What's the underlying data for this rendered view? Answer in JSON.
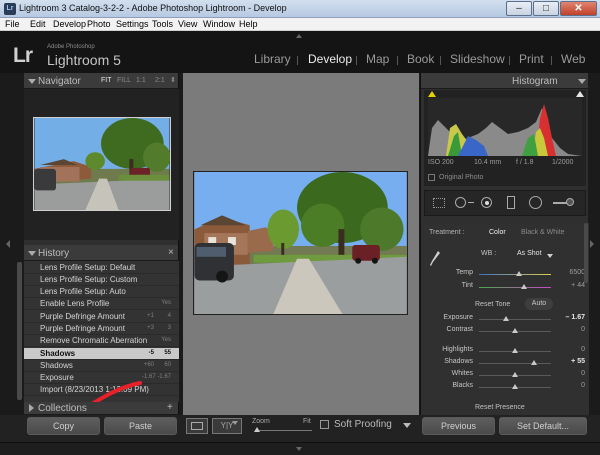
{
  "window": {
    "title": "Lightroom 3 Catalog-3-2-2 - Adobe Photoshop Lightroom - Develop",
    "icon_text": "Lr",
    "buttons": {
      "minimize": "–",
      "maximize": "□",
      "close": "✕"
    }
  },
  "menu": [
    "File",
    "Edit",
    "Develop",
    "Photo",
    "Settings",
    "Tools",
    "View",
    "Window",
    "Help"
  ],
  "identity": {
    "logo": "Lr",
    "sub": "Adobe Photoshop",
    "name": "Lightroom 5"
  },
  "modules": [
    {
      "label": "Library",
      "active": false
    },
    {
      "label": "Develop",
      "active": true
    },
    {
      "label": "Map",
      "active": false
    },
    {
      "label": "Book",
      "active": false
    },
    {
      "label": "Slideshow",
      "active": false
    },
    {
      "label": "Print",
      "active": false
    },
    {
      "label": "Web",
      "active": false
    }
  ],
  "navigator": {
    "title": "Navigator",
    "zoom": [
      "FIT",
      "FILL",
      "1:1",
      "2:1"
    ],
    "zoom_arrow": "⬍"
  },
  "history": {
    "title": "History",
    "close": "×",
    "items": [
      {
        "label": "Lens Profile Setup: Default",
        "v1": "",
        "v2": ""
      },
      {
        "label": "Lens Profile Setup: Custom",
        "v1": "",
        "v2": ""
      },
      {
        "label": "Lens Profile Setup: Auto",
        "v1": "",
        "v2": ""
      },
      {
        "label": "Enable Lens Profile",
        "v1": "",
        "v2": "Yes"
      },
      {
        "label": "Purple Defringe Amount",
        "v1": "+1",
        "v2": "4"
      },
      {
        "label": "Purple Defringe Amount",
        "v1": "+3",
        "v2": "3"
      },
      {
        "label": "Remove Chromatic Aberration",
        "v1": "",
        "v2": "Yes"
      },
      {
        "label": "Shadows",
        "v1": "-5",
        "v2": "55",
        "selected": true
      },
      {
        "label": "Shadows",
        "v1": "+60",
        "v2": "60"
      },
      {
        "label": "Exposure",
        "v1": "-1.67",
        "v2": "-1.67"
      },
      {
        "label": "Import (8/23/2013 1:13:09 PM)",
        "v1": "",
        "v2": ""
      }
    ]
  },
  "collections": {
    "title": "Collections",
    "add": "+"
  },
  "left_buttons": {
    "copy": "Copy",
    "paste": "Paste"
  },
  "histogram": {
    "title": "Histogram",
    "iso": "ISO 200",
    "focal": "10.4 mm",
    "aperture": "f / 1.8",
    "shutter": "1/2000",
    "original": "Original Photo"
  },
  "treatment": {
    "label": "Treatment :",
    "color": "Color",
    "bw": "Black & White"
  },
  "basic": {
    "wb_label": "WB :",
    "wb_value": "As Shot",
    "temp_label": "Temp",
    "temp_value": "6500",
    "temp_pos": 0.55,
    "tint_label": "Tint",
    "tint_value": "+ 44",
    "tint_pos": 0.62,
    "reset_tone": "Reset Tone",
    "auto": "Auto",
    "exposure_label": "Exposure",
    "exposure_value": "– 1.67",
    "exposure_pos": 0.38,
    "contrast_label": "Contrast",
    "contrast_value": "0",
    "contrast_pos": 0.5,
    "highlights_label": "Highlights",
    "highlights_value": "0",
    "highlights_pos": 0.5,
    "shadows_label": "Shadows",
    "shadows_value": "+ 55",
    "shadows_pos": 0.77,
    "whites_label": "Whites",
    "whites_value": "0",
    "whites_pos": 0.5,
    "blacks_label": "Blacks",
    "blacks_value": "0",
    "blacks_pos": 0.5,
    "reset_presence": "Reset Presence"
  },
  "right_buttons": {
    "previous": "Previous",
    "reset": "Set Default..."
  },
  "toolbar": {
    "yy": "Y|Y",
    "zoom_label": "Zoom",
    "fit_label": "Fit",
    "soft_proofing": "Soft Proofing"
  },
  "colors": {
    "accent_selected": "#c9c9c9",
    "panel": "#2f2f2f",
    "center_bg": "#7b7b7b",
    "annotation_arrow": "#e8202a"
  }
}
